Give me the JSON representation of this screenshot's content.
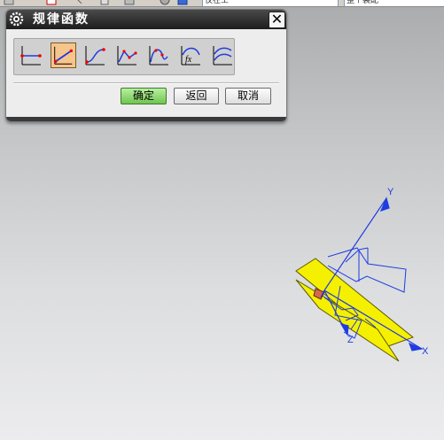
{
  "toolbar": {
    "field1": "仅在工",
    "field2": "整个装配"
  },
  "dialog": {
    "title": "规律函数",
    "close_symbol": "✕",
    "law_types": [
      {
        "name": "constant-law-icon"
      },
      {
        "name": "linear-law-icon",
        "selected": true
      },
      {
        "name": "cubic-law-icon"
      },
      {
        "name": "linear-along-spine-law-icon"
      },
      {
        "name": "cubic-along-spine-law-icon"
      },
      {
        "name": "equation-law-icon"
      },
      {
        "name": "law-curve-icon"
      }
    ],
    "buttons": {
      "ok": "确定",
      "back": "返回",
      "cancel": "取消"
    },
    "equation_icon_label": "fx"
  },
  "viewport": {
    "axis_y": "Y",
    "axis_x": "X",
    "axis_z": "Z",
    "plane_color": "#f5f000",
    "wire_color": "#1e3ce0"
  },
  "colors": {
    "accent_ok": "#7ccc58",
    "selected_icon": "#f6c58c",
    "titlebar": "#2a2a2a"
  }
}
